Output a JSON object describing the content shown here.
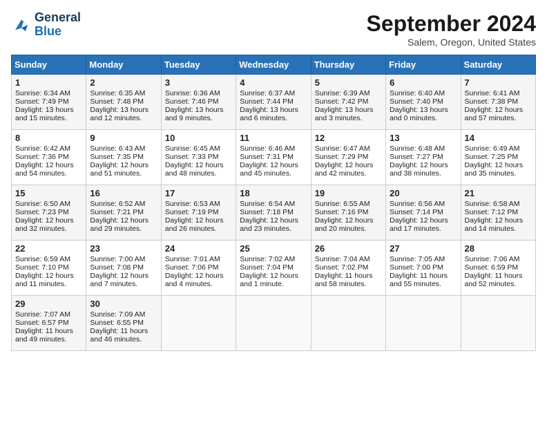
{
  "header": {
    "logo_line1": "General",
    "logo_line2": "Blue",
    "month_title": "September 2024",
    "location": "Salem, Oregon, United States"
  },
  "days_of_week": [
    "Sunday",
    "Monday",
    "Tuesday",
    "Wednesday",
    "Thursday",
    "Friday",
    "Saturday"
  ],
  "weeks": [
    [
      {
        "day": "1",
        "sunrise": "6:34 AM",
        "sunset": "7:49 PM",
        "daylight": "13 hours and 15 minutes."
      },
      {
        "day": "2",
        "sunrise": "6:35 AM",
        "sunset": "7:48 PM",
        "daylight": "13 hours and 12 minutes."
      },
      {
        "day": "3",
        "sunrise": "6:36 AM",
        "sunset": "7:46 PM",
        "daylight": "13 hours and 9 minutes."
      },
      {
        "day": "4",
        "sunrise": "6:37 AM",
        "sunset": "7:44 PM",
        "daylight": "13 hours and 6 minutes."
      },
      {
        "day": "5",
        "sunrise": "6:39 AM",
        "sunset": "7:42 PM",
        "daylight": "13 hours and 3 minutes."
      },
      {
        "day": "6",
        "sunrise": "6:40 AM",
        "sunset": "7:40 PM",
        "daylight": "13 hours and 0 minutes."
      },
      {
        "day": "7",
        "sunrise": "6:41 AM",
        "sunset": "7:38 PM",
        "daylight": "12 hours and 57 minutes."
      }
    ],
    [
      {
        "day": "8",
        "sunrise": "6:42 AM",
        "sunset": "7:36 PM",
        "daylight": "12 hours and 54 minutes."
      },
      {
        "day": "9",
        "sunrise": "6:43 AM",
        "sunset": "7:35 PM",
        "daylight": "12 hours and 51 minutes."
      },
      {
        "day": "10",
        "sunrise": "6:45 AM",
        "sunset": "7:33 PM",
        "daylight": "12 hours and 48 minutes."
      },
      {
        "day": "11",
        "sunrise": "6:46 AM",
        "sunset": "7:31 PM",
        "daylight": "12 hours and 45 minutes."
      },
      {
        "day": "12",
        "sunrise": "6:47 AM",
        "sunset": "7:29 PM",
        "daylight": "12 hours and 42 minutes."
      },
      {
        "day": "13",
        "sunrise": "6:48 AM",
        "sunset": "7:27 PM",
        "daylight": "12 hours and 38 minutes."
      },
      {
        "day": "14",
        "sunrise": "6:49 AM",
        "sunset": "7:25 PM",
        "daylight": "12 hours and 35 minutes."
      }
    ],
    [
      {
        "day": "15",
        "sunrise": "6:50 AM",
        "sunset": "7:23 PM",
        "daylight": "12 hours and 32 minutes."
      },
      {
        "day": "16",
        "sunrise": "6:52 AM",
        "sunset": "7:21 PM",
        "daylight": "12 hours and 29 minutes."
      },
      {
        "day": "17",
        "sunrise": "6:53 AM",
        "sunset": "7:19 PM",
        "daylight": "12 hours and 26 minutes."
      },
      {
        "day": "18",
        "sunrise": "6:54 AM",
        "sunset": "7:18 PM",
        "daylight": "12 hours and 23 minutes."
      },
      {
        "day": "19",
        "sunrise": "6:55 AM",
        "sunset": "7:16 PM",
        "daylight": "12 hours and 20 minutes."
      },
      {
        "day": "20",
        "sunrise": "6:56 AM",
        "sunset": "7:14 PM",
        "daylight": "12 hours and 17 minutes."
      },
      {
        "day": "21",
        "sunrise": "6:58 AM",
        "sunset": "7:12 PM",
        "daylight": "12 hours and 14 minutes."
      }
    ],
    [
      {
        "day": "22",
        "sunrise": "6:59 AM",
        "sunset": "7:10 PM",
        "daylight": "12 hours and 11 minutes."
      },
      {
        "day": "23",
        "sunrise": "7:00 AM",
        "sunset": "7:08 PM",
        "daylight": "12 hours and 7 minutes."
      },
      {
        "day": "24",
        "sunrise": "7:01 AM",
        "sunset": "7:06 PM",
        "daylight": "12 hours and 4 minutes."
      },
      {
        "day": "25",
        "sunrise": "7:02 AM",
        "sunset": "7:04 PM",
        "daylight": "12 hours and 1 minute."
      },
      {
        "day": "26",
        "sunrise": "7:04 AM",
        "sunset": "7:02 PM",
        "daylight": "11 hours and 58 minutes."
      },
      {
        "day": "27",
        "sunrise": "7:05 AM",
        "sunset": "7:00 PM",
        "daylight": "11 hours and 55 minutes."
      },
      {
        "day": "28",
        "sunrise": "7:06 AM",
        "sunset": "6:59 PM",
        "daylight": "11 hours and 52 minutes."
      }
    ],
    [
      {
        "day": "29",
        "sunrise": "7:07 AM",
        "sunset": "6:57 PM",
        "daylight": "11 hours and 49 minutes."
      },
      {
        "day": "30",
        "sunrise": "7:09 AM",
        "sunset": "6:55 PM",
        "daylight": "11 hours and 46 minutes."
      },
      null,
      null,
      null,
      null,
      null
    ]
  ]
}
